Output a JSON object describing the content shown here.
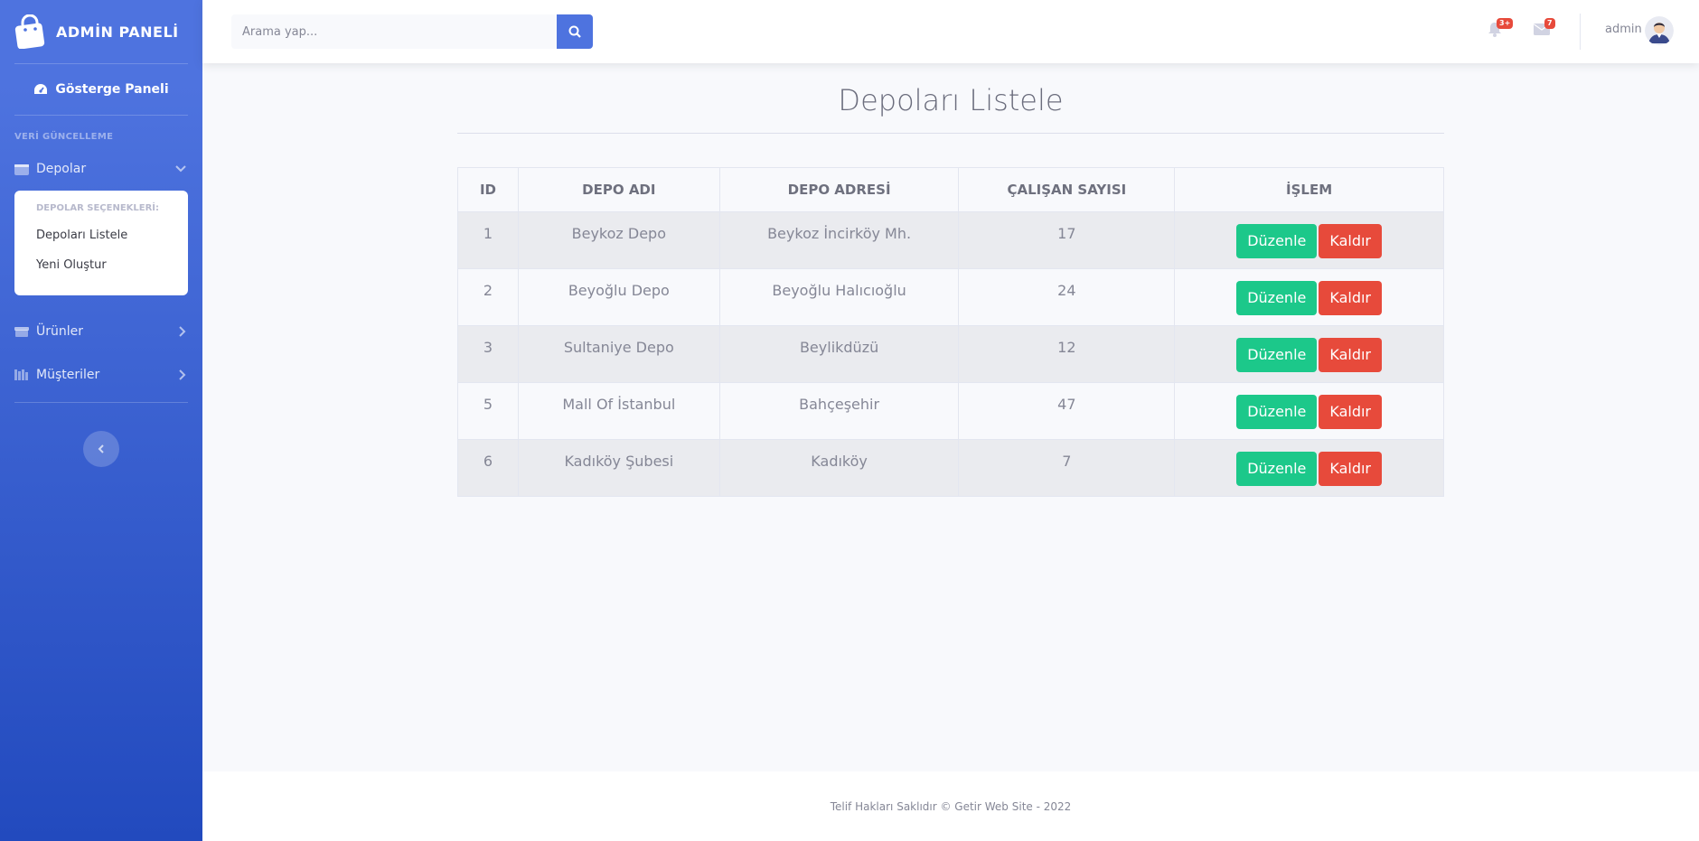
{
  "sidebar": {
    "brand": "ADMİN PANELİ",
    "dashboard_label": "Gösterge Paneli",
    "heading": "VERİ GÜNCELLEME",
    "items": [
      {
        "label": "Depolar",
        "icon": "warehouse-icon",
        "expanded": true
      },
      {
        "label": "Ürünler",
        "icon": "box-icon",
        "expanded": false
      },
      {
        "label": "Müşteriler",
        "icon": "users-icon",
        "expanded": false
      }
    ],
    "submenu": {
      "header": "DEPOLAR SEÇENEKLERİ:",
      "items": [
        "Depoları Listele",
        "Yeni Oluştur"
      ]
    }
  },
  "topbar": {
    "search_placeholder": "Arama yap...",
    "alerts_badge": "3+",
    "messages_badge": "7",
    "user_name": "admin"
  },
  "main": {
    "title": "Depoları Listele",
    "table": {
      "headers": [
        "ID",
        "DEPO ADI",
        "DEPO ADRESİ",
        "ÇALIŞAN SAYISI",
        "İŞLEM"
      ],
      "edit_label": "Düzenle",
      "delete_label": "Kaldır",
      "rows": [
        {
          "id": "1",
          "name": "Beykoz Depo",
          "address": "Beykoz İncirköy Mh.",
          "employees": "17"
        },
        {
          "id": "2",
          "name": "Beyoğlu Depo",
          "address": "Beyoğlu Halıcıoğlu",
          "employees": "24"
        },
        {
          "id": "3",
          "name": "Sultaniye Depo",
          "address": "Beylikdüzü",
          "employees": "12"
        },
        {
          "id": "5",
          "name": "Mall Of İstanbul",
          "address": "Bahçeşehir",
          "employees": "47"
        },
        {
          "id": "6",
          "name": "Kadıköy Şubesi",
          "address": "Kadıköy",
          "employees": "7"
        }
      ]
    }
  },
  "footer": {
    "text": "Telif Hakları Saklıdır © Getir Web Site - 2022"
  },
  "colors": {
    "primary": "#4e73df",
    "success": "#1cc88a",
    "danger": "#e74a3b"
  }
}
